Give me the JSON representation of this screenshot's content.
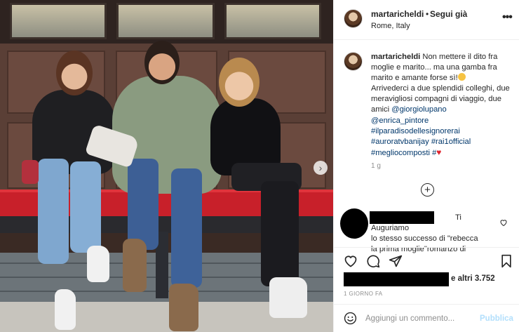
{
  "header": {
    "username": "martaricheldi",
    "separator": "•",
    "follow_label": "Segui già",
    "location": "Rome, Italy",
    "more_icon": "more-dots-icon"
  },
  "caption": {
    "username": "martaricheldi",
    "text_1": " Non mettere il dito fra moglie e marito... ma una gamba fra marito e amante forse sì!",
    "text_2": " Arrivederci a due splendidi colleghi, due meravigliosi compagni di viaggio, due amici ",
    "mention_1": "@giorgiolupano",
    "mention_2": "@enrica_pintore",
    "hashtag_1": "#ilparadisodellesignorerai",
    "hashtag_2": "#auroratvbanijay",
    "hashtag_3": "#rai1official",
    "hashtag_4": "#megliocomposti",
    "hashtag_5": "#",
    "time": "1 g"
  },
  "load_more_icon": "plus-circle-icon",
  "comment": {
    "line_1_tail": "Ti Auguriamo",
    "line_2": "lo stesso successo di \"rebecca",
    "line_3": "la prima moglie\"romanzo di"
  },
  "actions": {
    "likes_suffix": "e altri 3.752",
    "date": "1 GIORNO FA"
  },
  "comment_box": {
    "placeholder": "Aggiungi un commento...",
    "publish_label": "Pubblica"
  },
  "colors": {
    "link": "#00376b",
    "publish_disabled": "#b2dffc",
    "bench_red": "#c8202a"
  }
}
